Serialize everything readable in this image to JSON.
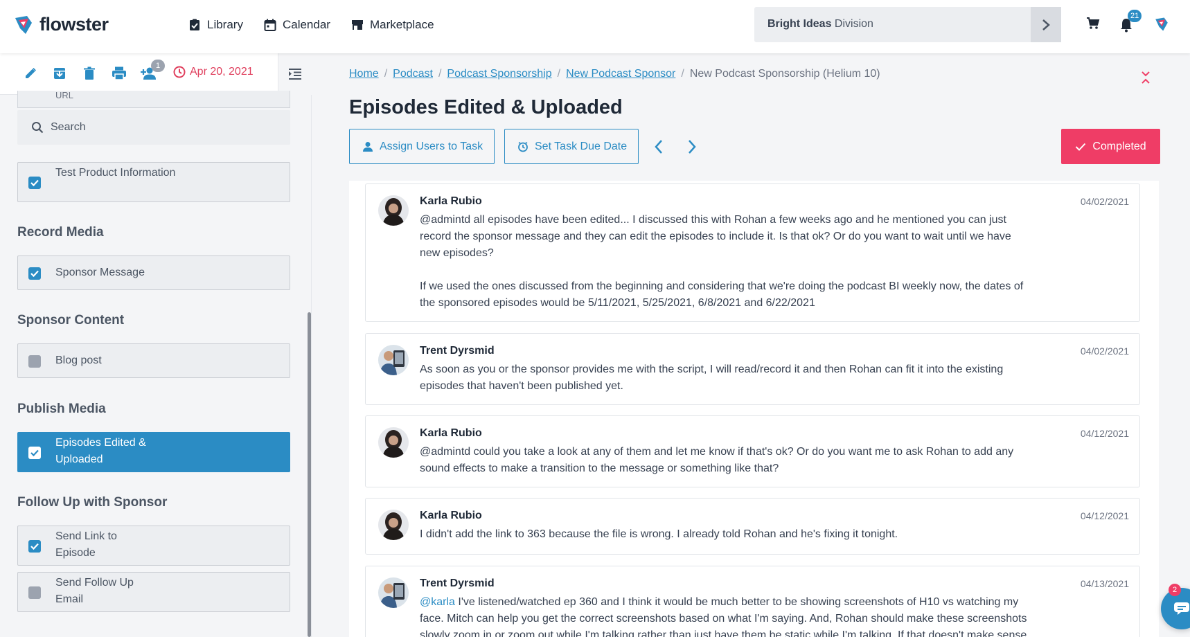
{
  "header": {
    "brand": "flowster",
    "nav": [
      {
        "label": "Library",
        "icon": "clipboard-check-icon"
      },
      {
        "label": "Calendar",
        "icon": "calendar-icon"
      },
      {
        "label": "Marketplace",
        "icon": "store-icon"
      }
    ],
    "division": {
      "name": "Bright Ideas",
      "suffix": "Division"
    },
    "notifications_count": "21"
  },
  "sidebar": {
    "toolbar": {
      "assigned_count": "1",
      "due_date": "Apr 20, 2021"
    },
    "url_field_label": "URL",
    "search_placeholder": "Search",
    "tasks_top": [
      {
        "label": "Test Product Information",
        "checked": true
      }
    ],
    "sections": [
      {
        "title": "Record Media",
        "tasks": [
          {
            "label": "Sponsor Message",
            "checked": true
          }
        ]
      },
      {
        "title": "Sponsor Content",
        "tasks": [
          {
            "label": "Blog post",
            "checked": false
          }
        ]
      },
      {
        "title": "Publish Media",
        "tasks": [
          {
            "label": "Episodes Edited & Uploaded",
            "checked": true,
            "active": true
          }
        ]
      },
      {
        "title": "Follow Up with Sponsor",
        "tasks": [
          {
            "label": "Send Link to Episode",
            "checked": true
          },
          {
            "label": "Send Follow Up Email",
            "checked": false
          }
        ]
      }
    ]
  },
  "main": {
    "breadcrumb": [
      "Home",
      "Podcast",
      "Podcast Sponsorship",
      "New Podcast Sponsor"
    ],
    "breadcrumb_current": "New Podcast Sponsorship (Helium 10)",
    "title": "Episodes Edited & Uploaded",
    "assign_label": "Assign Users to Task",
    "due_label": "Set Task Due Date",
    "completed_label": "Completed",
    "comments": [
      {
        "author": "Karla Rubio",
        "date": "04/02/2021",
        "lines": [
          "@admintd all episodes have been edited... I discussed this with Rohan a few weeks ago and he mentioned you can just",
          "record the sponsor message and they can edit the episodes to include it. Is that ok? Or do you want to wait until we have",
          "new episodes?",
          "",
          "If we used the ones discussed from the beginning and considering that we're doing the podcast BI weekly now, the dates of",
          "the sponsored episodes would be 5/11/2021, 5/25/2021, 6/8/2021 and 6/22/2021"
        ]
      },
      {
        "author": "Trent Dyrsmid",
        "date": "04/02/2021",
        "lines": [
          "As soon as you or the sponsor provides me with the script, I will read/record it and then Rohan can fit it into the existing",
          "episodes that haven't been published yet."
        ]
      },
      {
        "author": "Karla Rubio",
        "date": "04/12/2021",
        "lines": [
          "@admintd could you take a look at any of them and let me know if that's ok? Or do you want me to ask Rohan to add any",
          "sound effects to make a transition to the message or something like that?"
        ]
      },
      {
        "author": "Karla Rubio",
        "date": "04/12/2021",
        "lines": [
          "I didn't add the link to 363 because the file is wrong. I already told Rohan and he's fixing it tonight."
        ]
      },
      {
        "author": "Trent Dyrsmid",
        "date": "04/13/2021",
        "mention": "@karla",
        "lines": [
          " I've listened/watched ep 360 and I think it would be much better to be showing screenshots of H10 vs watching my",
          "face. Mitch can help you get the correct screenshots based on what I'm saying. And, Rohan should make these screenshots",
          "slowly zoom in or zoom out while I'm talking rather than just have them be static while I'm talking. If that doesn't make sense"
        ]
      }
    ]
  },
  "chat": {
    "badge": "2"
  },
  "colors": {
    "accent": "#2b8cc4",
    "danger": "#ef3d66"
  }
}
